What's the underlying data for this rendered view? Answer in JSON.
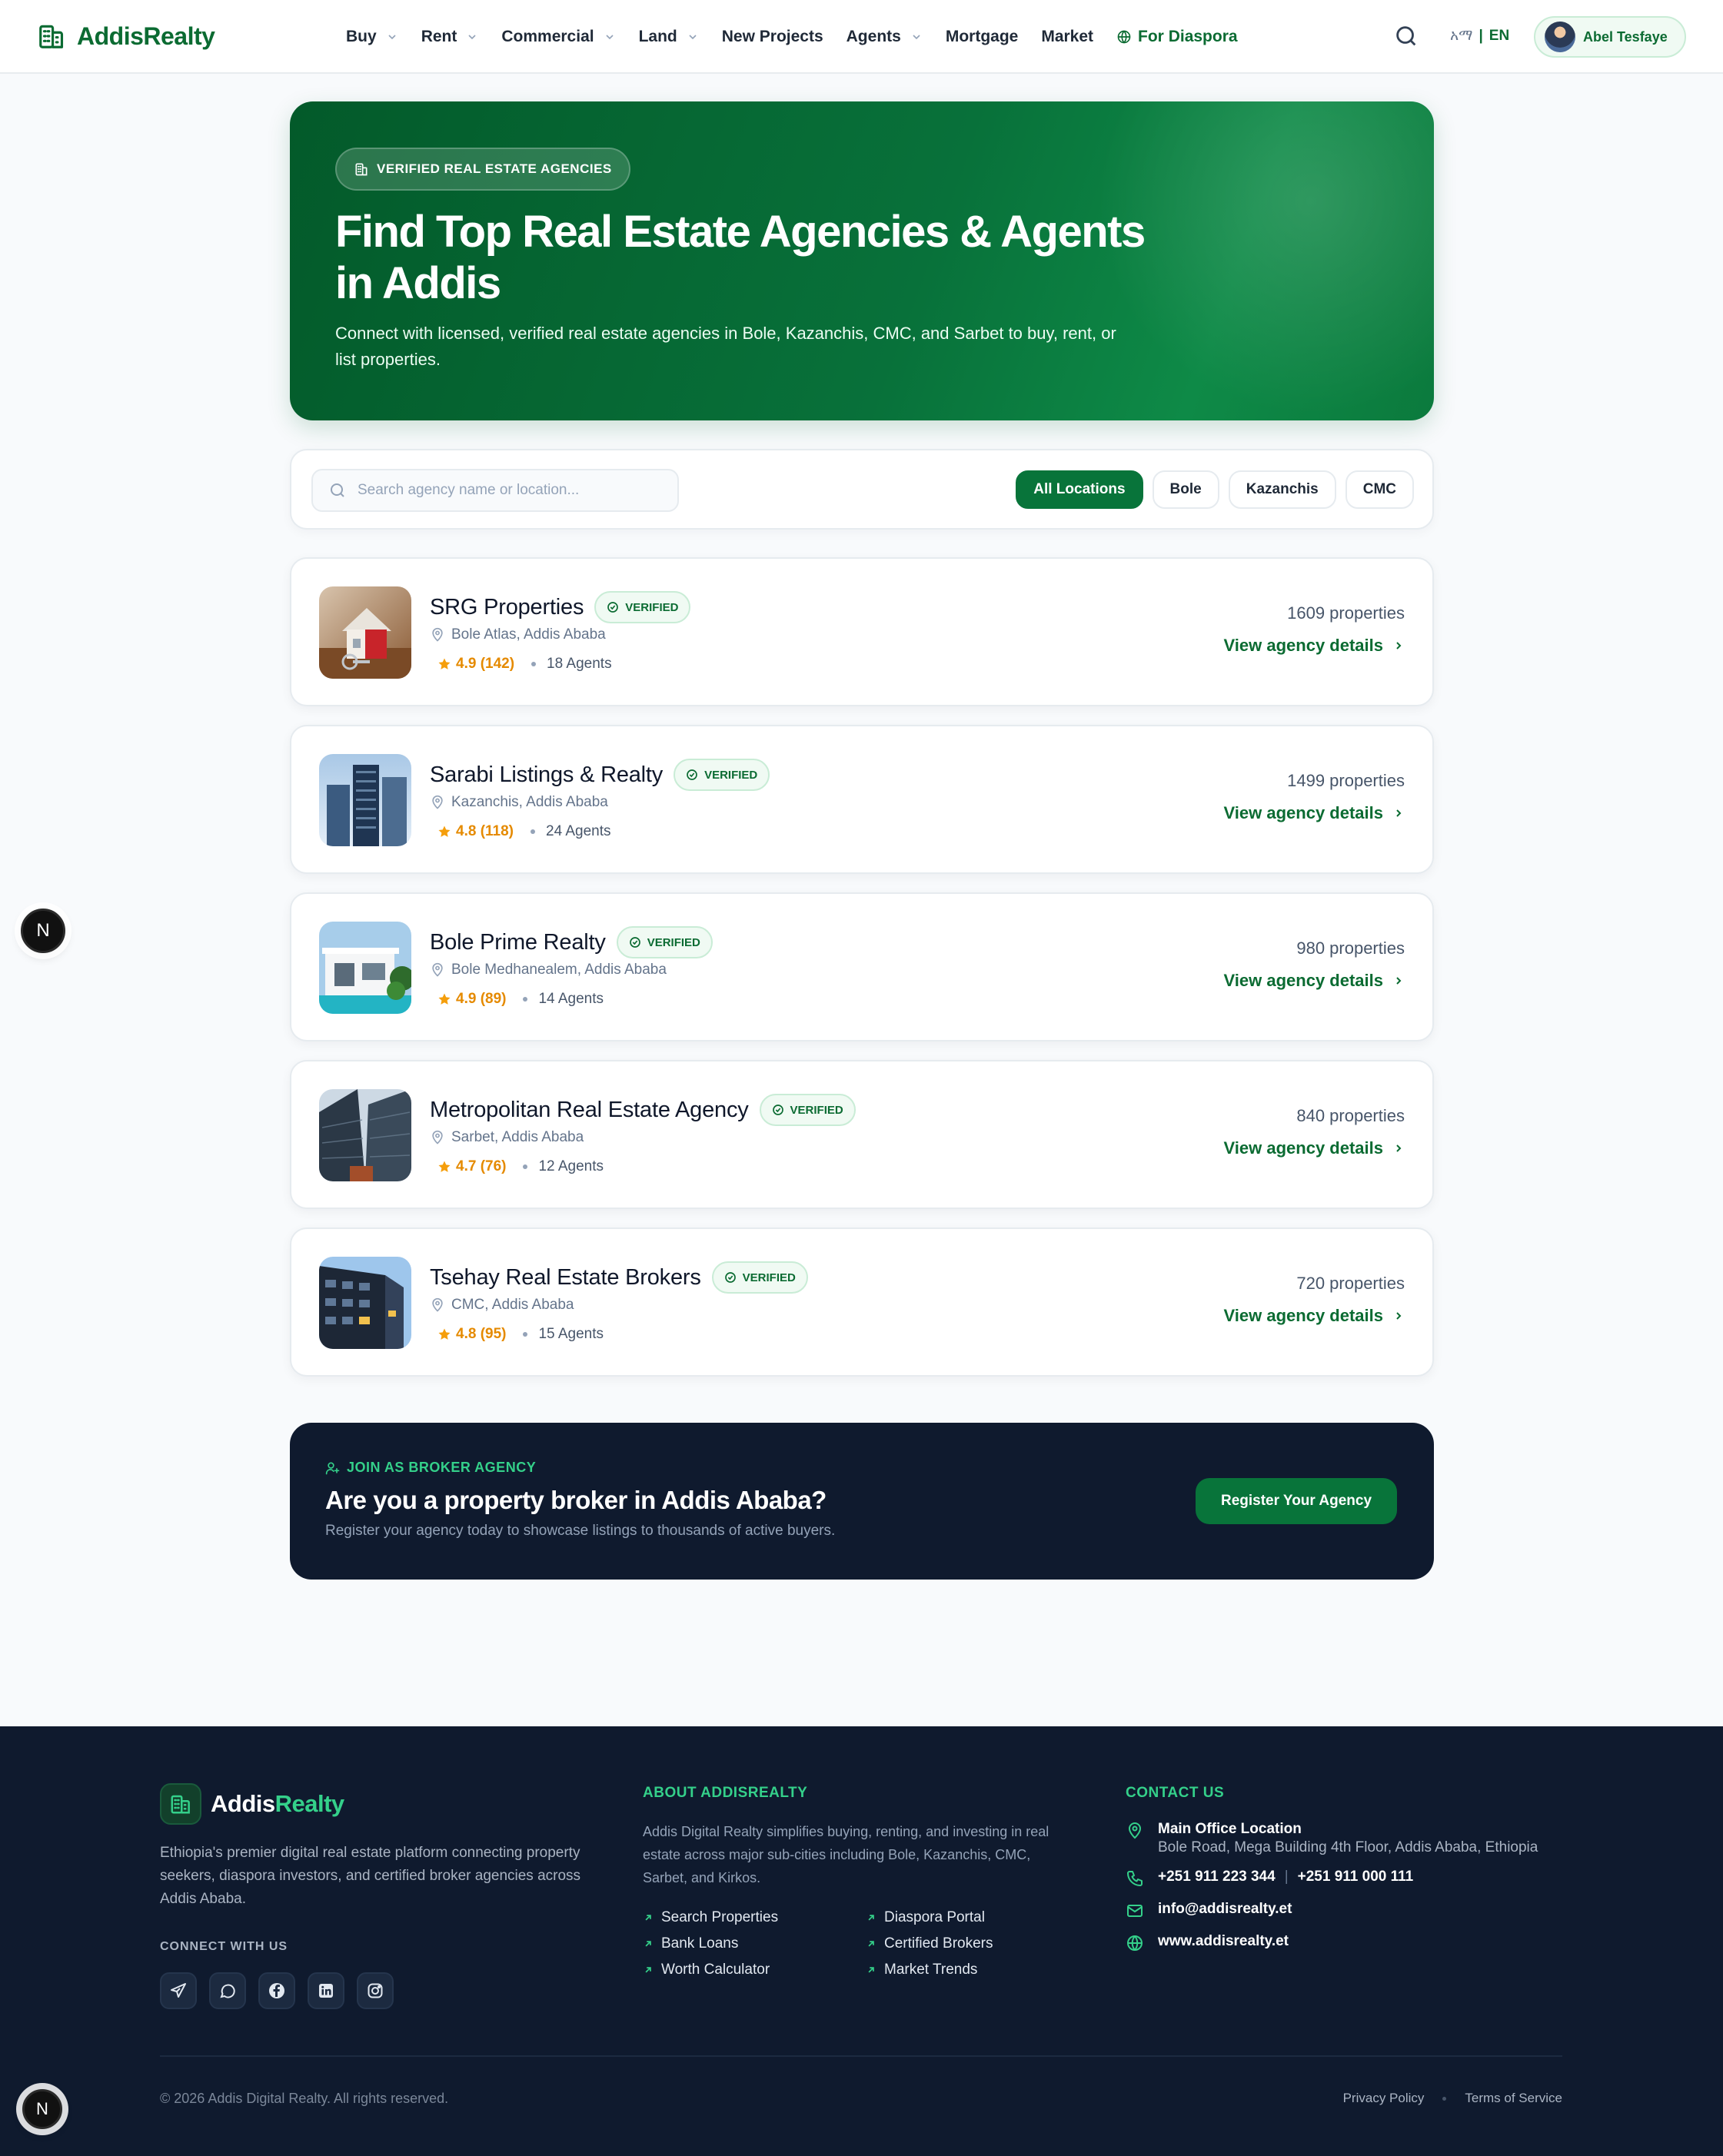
{
  "brand": {
    "name": "AddisRealty",
    "name_a": "Addis",
    "name_b": "Realty",
    "color": "#0b6b32"
  },
  "nav": {
    "items": [
      {
        "label": "Buy",
        "dropdown": true
      },
      {
        "label": "Rent",
        "dropdown": true
      },
      {
        "label": "Commercial",
        "dropdown": true
      },
      {
        "label": "Land",
        "dropdown": true
      },
      {
        "label": "New Projects",
        "dropdown": false
      },
      {
        "label": "Agents",
        "dropdown": true
      },
      {
        "label": "Mortgage",
        "dropdown": false
      },
      {
        "label": "Market",
        "dropdown": false
      }
    ],
    "diaspora_label": "For Diaspora",
    "lang_am": "አማ",
    "lang_sep": "|",
    "lang_en": "EN",
    "user_name": "Abel Tesfaye"
  },
  "hero": {
    "badge": "VERIFIED REAL ESTATE AGENCIES",
    "title": "Find Top Real Estate Agencies & Agents in Addis",
    "subtitle": "Connect with licensed, verified real estate agencies in Bole, Kazanchis, CMC, and Sarbet to buy, rent, or list properties."
  },
  "filters": {
    "search_placeholder": "Search agency name or location...",
    "search_value": "",
    "chips": [
      "All Locations",
      "Bole",
      "Kazanchis",
      "CMC"
    ],
    "active_chip": "All Locations"
  },
  "agencies": [
    {
      "name": "SRG Properties",
      "verified": "VERIFIED",
      "location": "Bole Atlas, Addis Ababa",
      "rating": "4.9 (142)",
      "agents": "18 Agents",
      "properties": "1609 properties",
      "cta": "View agency details"
    },
    {
      "name": "Sarabi Listings & Realty",
      "verified": "VERIFIED",
      "location": "Kazanchis, Addis Ababa",
      "rating": "4.8 (118)",
      "agents": "24 Agents",
      "properties": "1499 properties",
      "cta": "View agency details"
    },
    {
      "name": "Bole Prime Realty",
      "verified": "VERIFIED",
      "location": "Bole Medhanealem, Addis Ababa",
      "rating": "4.9 (89)",
      "agents": "14 Agents",
      "properties": "980 properties",
      "cta": "View agency details"
    },
    {
      "name": "Metropolitan Real Estate Agency",
      "verified": "VERIFIED",
      "location": "Sarbet, Addis Ababa",
      "rating": "4.7 (76)",
      "agents": "12 Agents",
      "properties": "840 properties",
      "cta": "View agency details"
    },
    {
      "name": "Tsehay Real Estate Brokers",
      "verified": "VERIFIED",
      "location": "CMC, Addis Ababa",
      "rating": "4.8 (95)",
      "agents": "15 Agents",
      "properties": "720 properties",
      "cta": "View agency details"
    }
  ],
  "cta": {
    "tag": "JOIN AS BROKER AGENCY",
    "title": "Are you a property broker in Addis Ababa?",
    "subtitle": "Register your agency today to showcase listings to thousands of active buyers.",
    "button": "Register Your Agency"
  },
  "floating_badge": "N",
  "footer": {
    "description": "Ethiopia's premier digital real estate platform connecting property seekers, diaspora investors, and certified broker agencies across Addis Ababa.",
    "connect_label": "CONNECT WITH US",
    "socials": [
      "telegram-icon",
      "chat-icon",
      "facebook-icon",
      "linkedin-icon",
      "instagram-icon"
    ],
    "about_heading": "ABOUT ADDISREALTY",
    "about_text": "Addis Digital Realty simplifies buying, renting, and investing in real estate across major sub-cities including Bole, Kazanchis, CMC, Sarbet, and Kirkos.",
    "links": [
      "Search Properties",
      "Diaspora Portal",
      "Bank Loans",
      "Certified Brokers",
      "Worth Calculator",
      "Market Trends"
    ],
    "contact_heading": "CONTACT US",
    "office_title": "Main Office Location",
    "office_address": "Bole Road, Mega Building 4th Floor, Addis Ababa, Ethiopia",
    "phone_1": "+251 911 223 344",
    "phone_sep": "|",
    "phone_2": "+251 911 000 111",
    "email": "info@addisrealty.et",
    "website": "www.addisrealty.et",
    "copyright": "© 2026 Addis Digital Realty. All rights reserved.",
    "privacy": "Privacy Policy",
    "terms": "Terms of Service"
  }
}
